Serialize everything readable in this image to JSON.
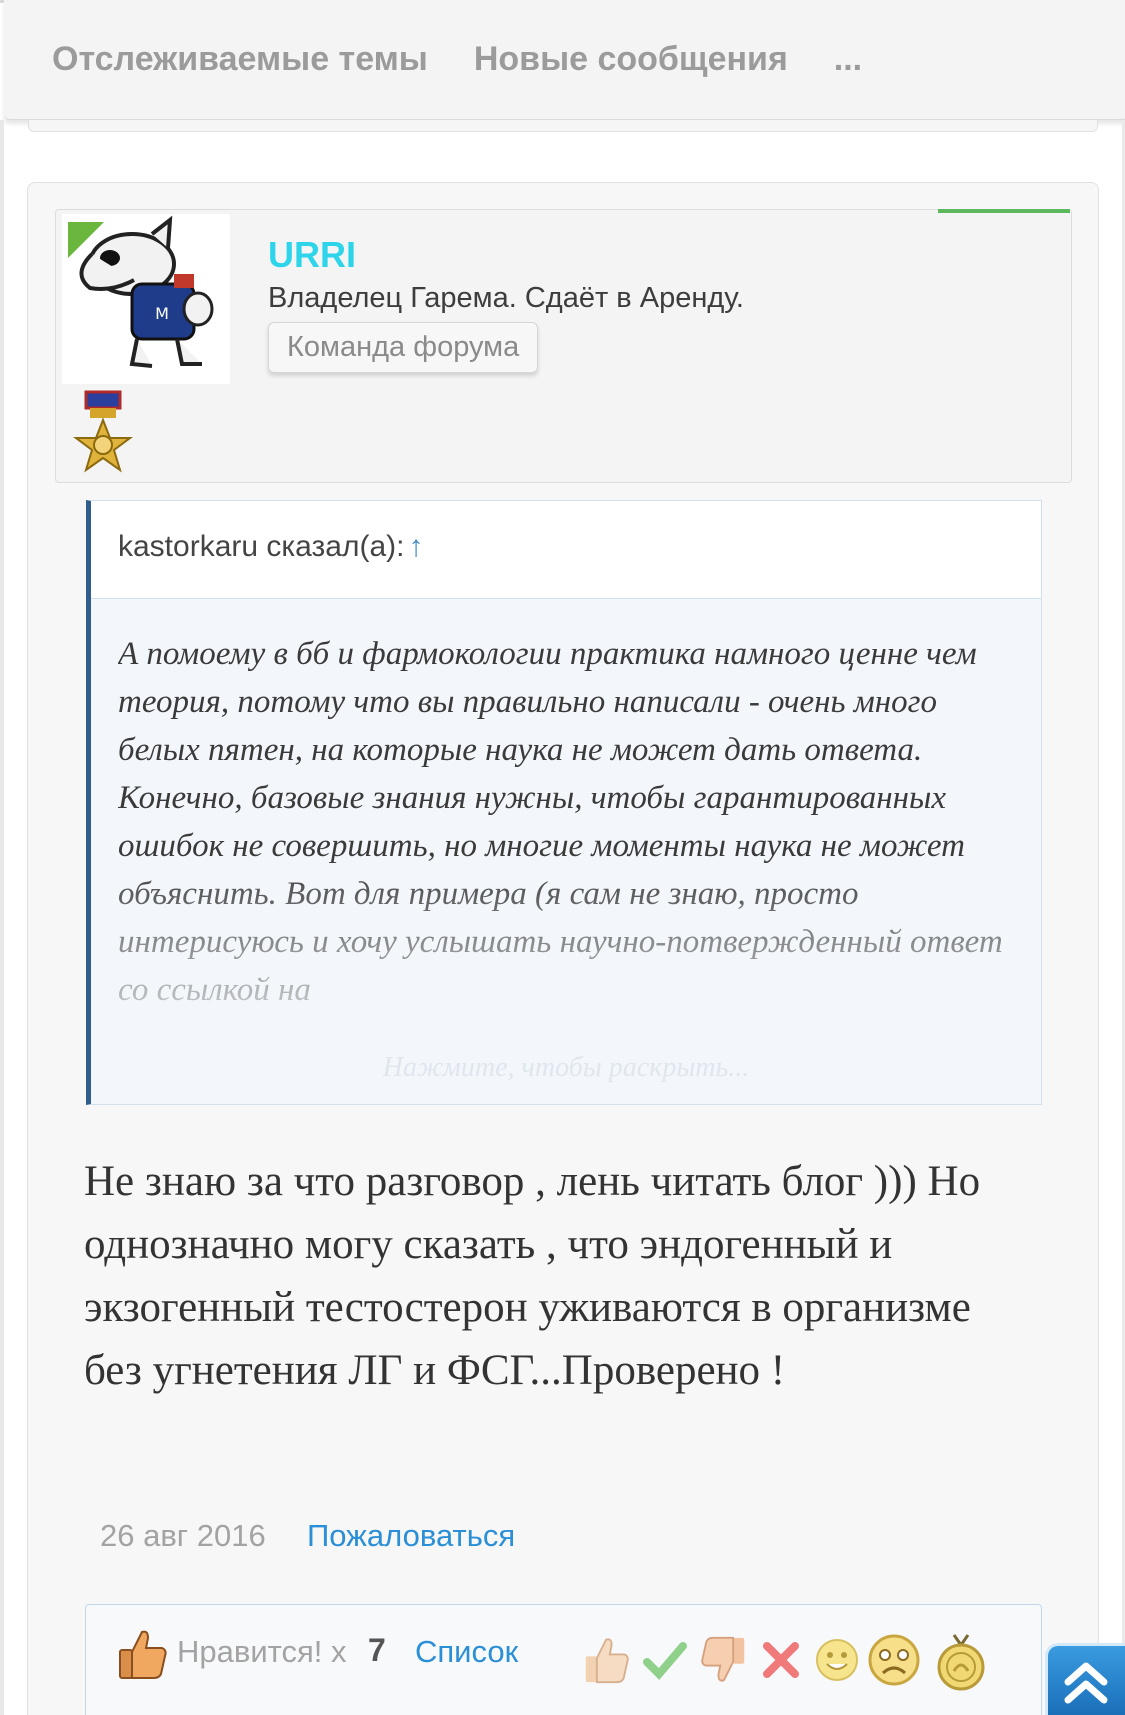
{
  "nav": {
    "items": [
      "Отслеживаемые темы",
      "Новые сообщения",
      "..."
    ]
  },
  "post": {
    "author": {
      "name": "URRI",
      "title": "Владелец Гарема. Сдаёт в Аренду.",
      "badge": "Команда форума"
    },
    "quote": {
      "author": "kastorkaru сказал(а):",
      "arrow": "↑",
      "text": "А помоему в бб и фармокологии практика намного ценне чем теория, потому что вы правильно написали - очень много белых пятен, на которые наука не может дать ответа. Конечно, базовые знания нужны, чтобы гарантированных ошибок не совершить, но многие моменты наука не может объяснить. Вот для примера (я сам не знаю, просто интерисуюсь и хочу услышать научно-потвержденный ответ со ссылкой на",
      "expand": "Нажмите, чтобы раскрыть..."
    },
    "body": "Не знаю за что разговор , лень читать блог ))) Но однозначно могу сказать , что эндогенный и экзогенный тестостерон уживаются в организме без угнетения ЛГ и ФСГ...Проверено !",
    "date": "26 авг 2016",
    "report": "Пожаловаться"
  },
  "likes": {
    "label": "Нравится! x",
    "count": "7",
    "list": "Список"
  },
  "ratings": [
    "thumbs-up-icon",
    "check-icon",
    "thumbs-down-icon",
    "cross-icon",
    "smile-icon",
    "sad-face-icon",
    "medal-icon"
  ],
  "colors": {
    "username": "#2ed5ea",
    "link": "#2a8fd6",
    "online": "#6bb63d",
    "quote_border": "#2f5d8c"
  }
}
